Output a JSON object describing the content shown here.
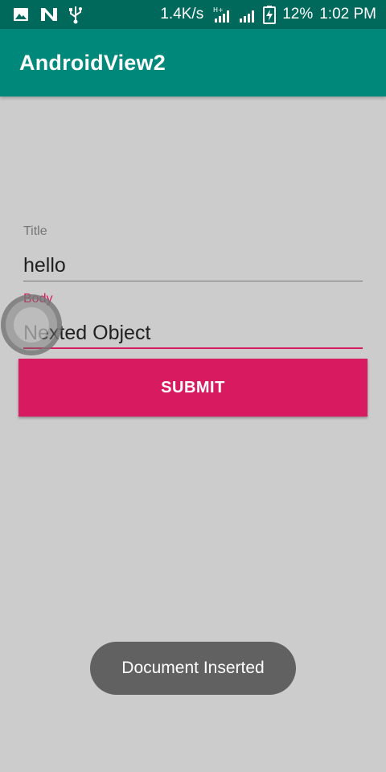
{
  "status_bar": {
    "net_speed": "1.4K/s",
    "network_type": "H+",
    "battery": "12%",
    "time": "1:02 PM",
    "icons": [
      "image-icon",
      "n-icon",
      "usb-icon",
      "signal-icon",
      "signal-icon",
      "battery-charging-icon"
    ]
  },
  "app_bar": {
    "title": "AndroidView2"
  },
  "form": {
    "title_label": "Title",
    "title_value": "hello",
    "body_label": "Body",
    "body_value": "Nexted Object"
  },
  "submit_label": "SUBMIT",
  "toast": {
    "message": "Document Inserted"
  },
  "colors": {
    "status_bar": "#00695c",
    "app_bar": "#00897b",
    "accent": "#d81b60",
    "background": "#cccccc",
    "toast": "#616161"
  }
}
